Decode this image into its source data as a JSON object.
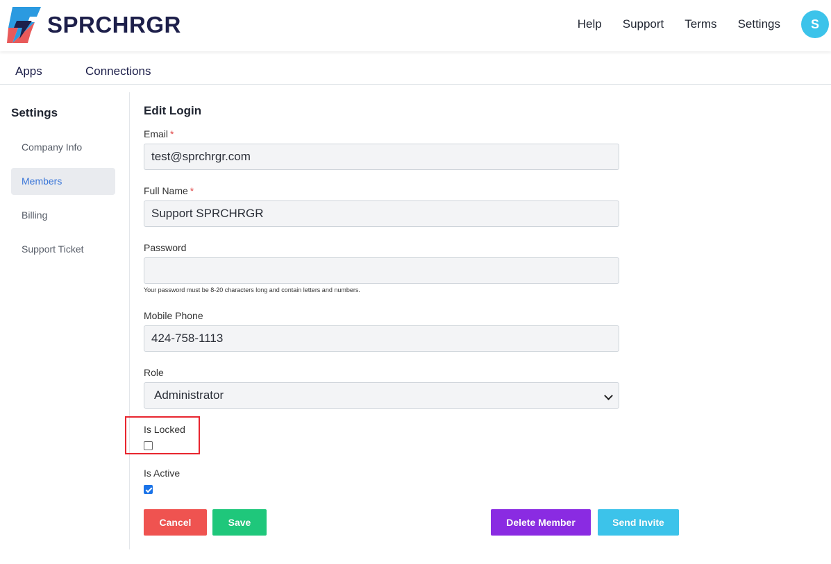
{
  "brand": {
    "name": "SPRCHRGR"
  },
  "top_nav": [
    "Help",
    "Support",
    "Terms",
    "Settings"
  ],
  "user": {
    "initial": "S"
  },
  "subnav": [
    "Apps",
    "Connections"
  ],
  "sidebar": {
    "title": "Settings",
    "items": [
      "Company Info",
      "Members",
      "Billing",
      "Support Ticket"
    ],
    "active": "Members"
  },
  "form": {
    "title": "Edit Login",
    "email_label": "Email",
    "email_value": "test@sprchrgr.com",
    "fullname_label": "Full Name",
    "fullname_value": "Support SPRCHRGR",
    "password_label": "Password",
    "password_value": "",
    "password_help": "Your password must be 8-20 characters long and contain letters and numbers.",
    "mobile_label": "Mobile Phone",
    "mobile_value": "424-758-1113",
    "role_label": "Role",
    "role_value": "Administrator",
    "required_mark": "*",
    "is_locked_label": "Is Locked",
    "is_locked": false,
    "is_active_label": "Is Active",
    "is_active": true
  },
  "buttons": {
    "cancel": "Cancel",
    "save": "Save",
    "delete": "Delete Member",
    "invite": "Send Invite"
  },
  "colors": {
    "cancel": "#ef5350",
    "save": "#1fc77b",
    "delete": "#8a2be2",
    "invite": "#3cc3ea",
    "highlight": "#e8262f",
    "avatar": "#3cc3ea"
  }
}
